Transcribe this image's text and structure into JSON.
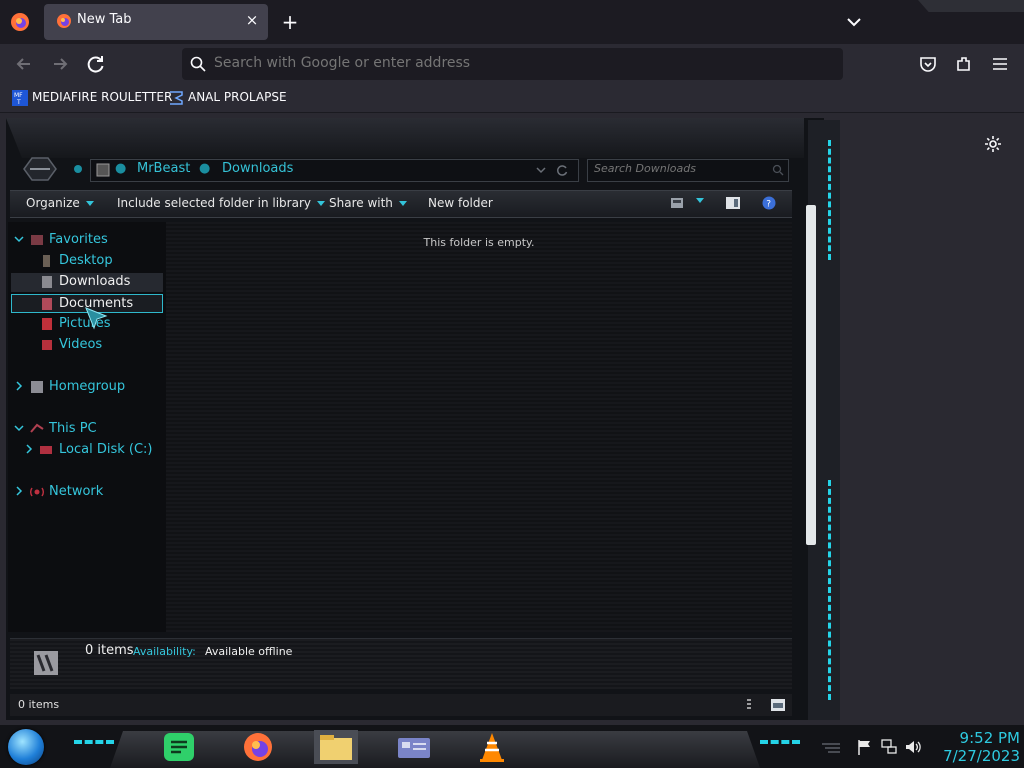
{
  "browser": {
    "tab": {
      "label": "New Tab",
      "close": "×"
    },
    "new_tab": "+",
    "urlbar": {
      "placeholder": "Search with Google or enter address"
    },
    "bookmarks": [
      {
        "label": "MEDIAFIRE ROULETTER",
        "icon": "mediafire-icon"
      },
      {
        "label": "ANAL PROLAPSE",
        "icon": "sigma-icon"
      }
    ]
  },
  "explorer": {
    "breadcrumb": [
      "MrBeast",
      "Downloads"
    ],
    "search_placeholder": "Search Downloads",
    "toolbar": {
      "organize": "Organize",
      "include_library": "Include selected folder in library",
      "share_with": "Share with",
      "new_folder": "New folder"
    },
    "nav": {
      "favorites": "Favorites",
      "desktop": "Desktop",
      "downloads": "Downloads",
      "documents": "Documents",
      "pictures": "Pictures",
      "videos": "Videos",
      "homegroup": "Homegroup",
      "this_pc": "This PC",
      "local_disk": "Local Disk (C:)",
      "network": "Network"
    },
    "empty_message": "This folder is empty.",
    "details": {
      "count": "0 items",
      "availability_label": "Availability:",
      "availability_value": "Available offline"
    },
    "status": "0 items"
  },
  "taskbar": {
    "time": "9:52 PM",
    "date": "7/27/2023"
  },
  "colors": {
    "accent": "#35c6dc",
    "firefox_bg": "#1c1b22"
  }
}
